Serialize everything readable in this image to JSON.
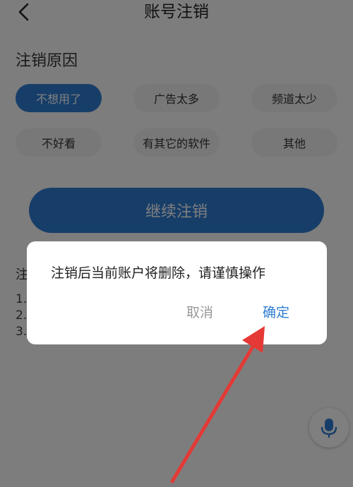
{
  "header": {
    "title": "账号注销",
    "back_icon": "chevron-left-icon"
  },
  "reasons": {
    "title": "注销原因",
    "items": [
      "不想用了",
      "广告太多",
      "频道太少",
      "不好看",
      "有其它的软件",
      "其他"
    ],
    "selected": "不想用了"
  },
  "continue_label": "继续注销",
  "notes": {
    "title": "注",
    "lines": [
      "1.",
      "2.",
      "3."
    ]
  },
  "mic_icon": "microphone-icon",
  "dialog": {
    "message": "注销后当前账户将删除，请谨慎操作",
    "cancel": "取消",
    "confirm": "确定"
  },
  "colors": {
    "accent": "#2e7dd3",
    "annotation_arrow": "#e53935"
  }
}
